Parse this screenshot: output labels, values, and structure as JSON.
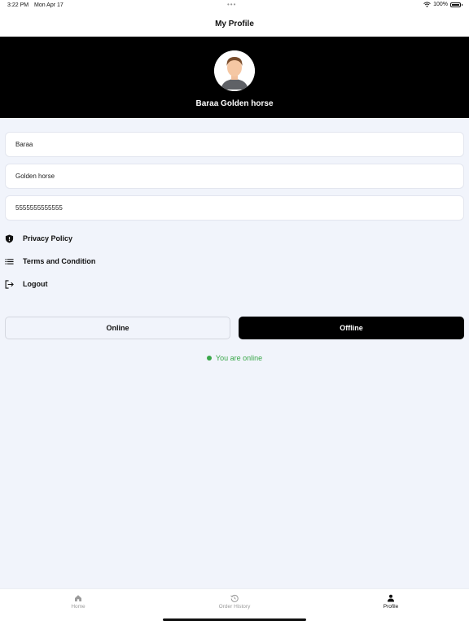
{
  "status": {
    "time": "3:22 PM",
    "date": "Mon Apr 17",
    "battery": "100%"
  },
  "nav": {
    "title": "My Profile"
  },
  "profile": {
    "display_name": "Baraa Golden horse"
  },
  "fields": [
    {
      "value": "Baraa"
    },
    {
      "value": "Golden horse"
    },
    {
      "value": "5555555555555"
    }
  ],
  "menu": [
    {
      "label": "Privacy Policy",
      "icon": "shield-icon"
    },
    {
      "label": "Terms and Condition",
      "icon": "list-icon"
    },
    {
      "label": "Logout",
      "icon": "logout-icon"
    }
  ],
  "availability": {
    "online_label": "Online",
    "offline_label": "Offline",
    "status_text": "You are online"
  },
  "tabs": [
    {
      "label": "Home",
      "icon": "home-icon"
    },
    {
      "label": "Order History",
      "icon": "history-icon"
    },
    {
      "label": "Profile",
      "icon": "person-icon"
    }
  ],
  "colors": {
    "header": "#000000",
    "online": "#3aa74a",
    "background": "#f1f4fb"
  }
}
